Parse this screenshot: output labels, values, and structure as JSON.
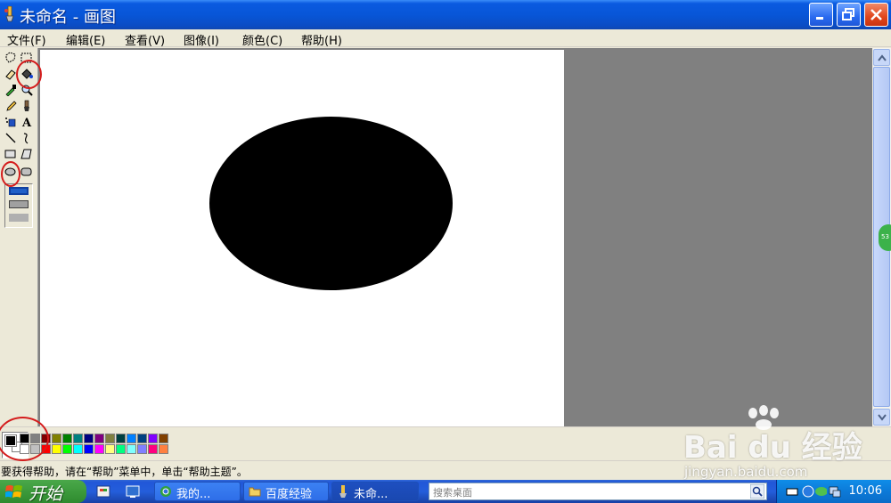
{
  "window": {
    "title": "未命名 - 画图"
  },
  "menu": {
    "items": [
      {
        "label": "文件(F)"
      },
      {
        "label": "编辑(E)"
      },
      {
        "label": "查看(V)"
      },
      {
        "label": "图像(I)"
      },
      {
        "label": "颜色(C)"
      },
      {
        "label": "帮助(H)"
      }
    ]
  },
  "tools": [
    "free-form-select",
    "select",
    "eraser",
    "fill-with-color",
    "pick-color",
    "magnifier",
    "pencil",
    "brush",
    "airbrush",
    "text",
    "line",
    "curve",
    "rectangle",
    "polygon",
    "ellipse",
    "rounded-rectangle"
  ],
  "canvas": {
    "shape": "ellipse",
    "fill_color": "#000000",
    "background_color": "#ffffff"
  },
  "palette": {
    "foreground": "#000000",
    "background": "#ffffff",
    "colors_top": [
      "#000000",
      "#808080",
      "#800000",
      "#808000",
      "#008000",
      "#008080",
      "#000080",
      "#800080",
      "#808040",
      "#004040",
      "#0080ff",
      "#004080",
      "#8000ff",
      "#804000"
    ],
    "colors_bottom": [
      "#ffffff",
      "#c0c0c0",
      "#ff0000",
      "#ffff00",
      "#00ff00",
      "#00ffff",
      "#0000ff",
      "#ff00ff",
      "#ffff80",
      "#00ff80",
      "#80ffff",
      "#8080ff",
      "#ff0080",
      "#ff8040"
    ]
  },
  "status": {
    "text": "要获得帮助，请在“帮助”菜单中，单击“帮助主题”。"
  },
  "watermark": {
    "logo": "Bai du 经验",
    "url": "jingyan.baidu.com"
  },
  "taskbar": {
    "start_label": "开始",
    "tasks": [
      {
        "label": "我的..."
      },
      {
        "label": "百度经验"
      },
      {
        "label": "未命..."
      }
    ],
    "search_placeholder": "搜索桌面",
    "clock": "10:06"
  },
  "side_badge": "53",
  "colors": {
    "title_bar": "#0856d8",
    "annotation": "#d41c1c",
    "workspace": "#808080"
  }
}
